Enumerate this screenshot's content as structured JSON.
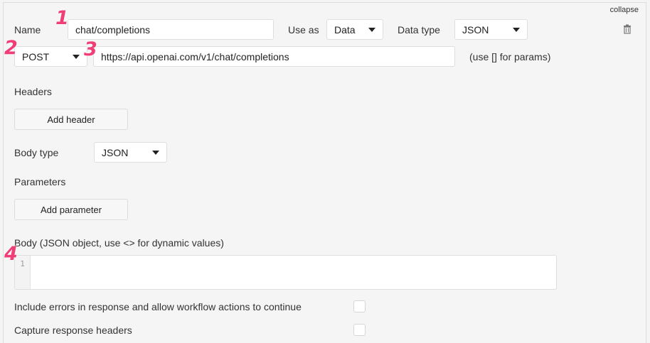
{
  "header": {
    "collapse_label": "collapse"
  },
  "form": {
    "name_label": "Name",
    "name_value": "chat/completions",
    "use_as_label": "Use as",
    "use_as_value": "Data",
    "data_type_label": "Data type",
    "data_type_value": "JSON",
    "method_value": "POST",
    "url_value": "https://api.openai.com/v1/chat/completions",
    "url_hint": "(use [] for params)",
    "headers_label": "Headers",
    "add_header_label": "Add header",
    "body_type_label": "Body type",
    "body_type_value": "JSON",
    "parameters_label": "Parameters",
    "add_parameter_label": "Add parameter",
    "body_label": "Body (JSON object, use <> for dynamic values)",
    "body_line_number": "1",
    "body_value": "",
    "include_errors_label": "Include errors in response and allow workflow actions to continue",
    "include_errors_checked": false,
    "capture_headers_label": "Capture response headers",
    "capture_headers_checked": false
  },
  "annotations": [
    "1",
    "2",
    "3",
    "4"
  ],
  "icons": {
    "delete": "trash-icon"
  },
  "colors": {
    "annotation": "#ef3f76",
    "background": "#f5f5f5",
    "input_border": "#dedede"
  }
}
